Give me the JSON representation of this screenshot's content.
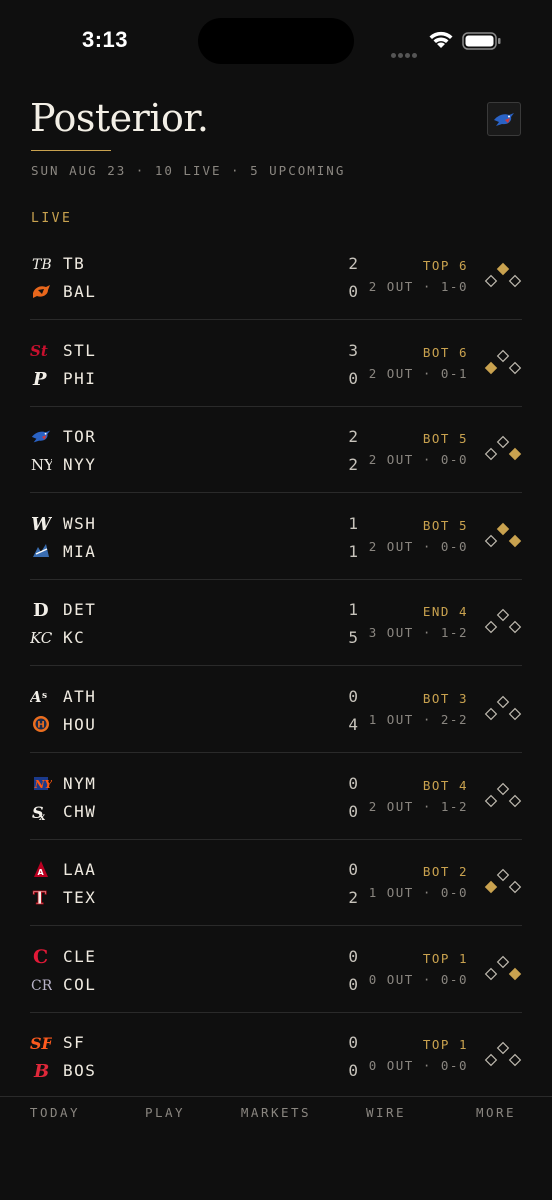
{
  "status": {
    "time": "3:13"
  },
  "header": {
    "title": "Posterior.",
    "subtitle": "SUN AUG 23 · 10 LIVE · 5 UPCOMING",
    "badge_icon": "blue-jays-logo-icon"
  },
  "section": {
    "label": "LIVE"
  },
  "colors": {
    "accent": "#c9a24f",
    "background": "#0f0f0f",
    "divider": "#2a2a2a"
  },
  "games": [
    {
      "away": {
        "abbr": "TB",
        "score": "2",
        "icon": "rays-logo-icon"
      },
      "home": {
        "abbr": "BAL",
        "score": "0",
        "icon": "orioles-logo-icon"
      },
      "inning": "TOP 6",
      "count": "2 OUT · 1-0",
      "bases": {
        "first": false,
        "second": true,
        "third": false
      }
    },
    {
      "away": {
        "abbr": "STL",
        "score": "3",
        "icon": "cardinals-logo-icon"
      },
      "home": {
        "abbr": "PHI",
        "score": "0",
        "icon": "phillies-logo-icon"
      },
      "inning": "BOT 6",
      "count": "2 OUT · 0-1",
      "bases": {
        "first": false,
        "second": false,
        "third": true
      }
    },
    {
      "away": {
        "abbr": "TOR",
        "score": "2",
        "icon": "blue-jays-logo-icon"
      },
      "home": {
        "abbr": "NYY",
        "score": "2",
        "icon": "yankees-logo-icon"
      },
      "inning": "BOT 5",
      "count": "2 OUT · 0-0",
      "bases": {
        "first": true,
        "second": false,
        "third": false
      }
    },
    {
      "away": {
        "abbr": "WSH",
        "score": "1",
        "icon": "nationals-logo-icon"
      },
      "home": {
        "abbr": "MIA",
        "score": "1",
        "icon": "marlins-logo-icon"
      },
      "inning": "BOT 5",
      "count": "2 OUT · 0-0",
      "bases": {
        "first": true,
        "second": true,
        "third": false
      }
    },
    {
      "away": {
        "abbr": "DET",
        "score": "1",
        "icon": "tigers-logo-icon"
      },
      "home": {
        "abbr": "KC",
        "score": "5",
        "icon": "royals-logo-icon"
      },
      "inning": "END 4",
      "count": "3 OUT · 1-2",
      "bases": {
        "first": false,
        "second": false,
        "third": false
      }
    },
    {
      "away": {
        "abbr": "ATH",
        "score": "0",
        "icon": "athletics-logo-icon"
      },
      "home": {
        "abbr": "HOU",
        "score": "4",
        "icon": "astros-logo-icon"
      },
      "inning": "BOT 3",
      "count": "1 OUT · 2-2",
      "bases": {
        "first": false,
        "second": false,
        "third": false
      }
    },
    {
      "away": {
        "abbr": "NYM",
        "score": "0",
        "icon": "mets-logo-icon"
      },
      "home": {
        "abbr": "CHW",
        "score": "0",
        "icon": "white-sox-logo-icon"
      },
      "inning": "BOT 4",
      "count": "2 OUT · 1-2",
      "bases": {
        "first": false,
        "second": false,
        "third": false
      }
    },
    {
      "away": {
        "abbr": "LAA",
        "score": "0",
        "icon": "angels-logo-icon"
      },
      "home": {
        "abbr": "TEX",
        "score": "2",
        "icon": "rangers-logo-icon"
      },
      "inning": "BOT 2",
      "count": "1 OUT · 0-0",
      "bases": {
        "first": false,
        "second": false,
        "third": true
      }
    },
    {
      "away": {
        "abbr": "CLE",
        "score": "0",
        "icon": "guardians-logo-icon"
      },
      "home": {
        "abbr": "COL",
        "score": "0",
        "icon": "rockies-logo-icon"
      },
      "inning": "TOP 1",
      "count": "0 OUT · 0-0",
      "bases": {
        "first": true,
        "second": false,
        "third": false
      }
    },
    {
      "away": {
        "abbr": "SF",
        "score": "0",
        "icon": "giants-logo-icon"
      },
      "home": {
        "abbr": "BOS",
        "score": "0",
        "icon": "red-sox-logo-icon"
      },
      "inning": "TOP 1",
      "count": "0 OUT · 0-0",
      "bases": {
        "first": false,
        "second": false,
        "third": false
      }
    }
  ],
  "tabs": [
    {
      "label": "TODAY"
    },
    {
      "label": "PLAY"
    },
    {
      "label": "MARKETS"
    },
    {
      "label": "WIRE"
    },
    {
      "label": "MORE"
    }
  ]
}
